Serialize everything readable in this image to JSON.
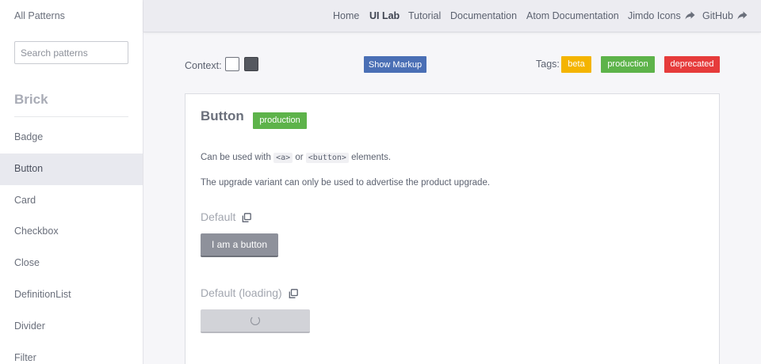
{
  "sidebar": {
    "title": "All Patterns",
    "search_placeholder": "Search patterns",
    "group": "Brick",
    "items": [
      {
        "label": "Badge"
      },
      {
        "label": "Button"
      },
      {
        "label": "Card"
      },
      {
        "label": "Checkbox"
      },
      {
        "label": "Close"
      },
      {
        "label": "DefinitionList"
      },
      {
        "label": "Divider"
      },
      {
        "label": "Filter"
      }
    ],
    "active_item": "Button"
  },
  "nav": {
    "links": [
      {
        "label": "Home"
      },
      {
        "label": "UI Lab",
        "active": true
      },
      {
        "label": "Tutorial"
      },
      {
        "label": "Documentation"
      },
      {
        "label": "Atom Documentation"
      },
      {
        "label": "Jimdo Icons",
        "icon": "share-arrow-icon"
      },
      {
        "label": "GitHub",
        "icon": "share-arrow-icon"
      }
    ]
  },
  "toolbar": {
    "context_label": "Context:",
    "show_markup_label": "Show Markup",
    "tags_label": "Tags:",
    "tags": [
      {
        "label": "beta",
        "color": "#f4b400"
      },
      {
        "label": "production",
        "color": "#5db34a"
      },
      {
        "label": "deprecated",
        "color": "#e63b3b"
      }
    ]
  },
  "card": {
    "title": "Button",
    "badge": "production",
    "badge_color": "#5db34a",
    "desc1": {
      "prefix": "Can be used with",
      "code1": "<a>",
      "middle": "or",
      "code2": "<button>",
      "suffix": "elements."
    },
    "desc2": "The upgrade variant can only be used to advertise the product upgrade.",
    "variants": [
      {
        "title": "Default",
        "button_label": "I am a button"
      },
      {
        "title": "Default (loading)"
      }
    ]
  }
}
